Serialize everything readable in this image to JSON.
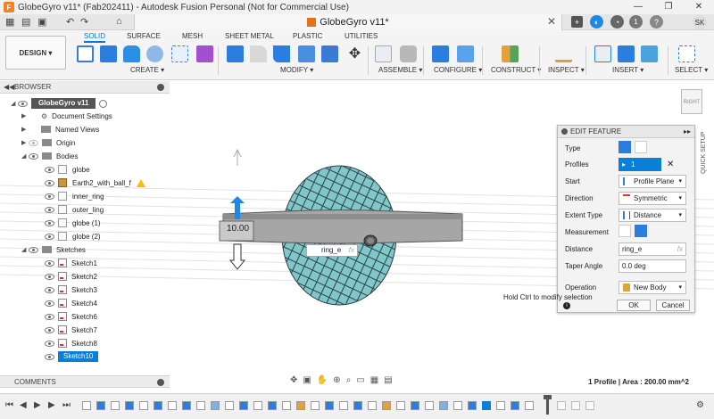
{
  "window": {
    "title": "GlobeGyro v11* (Fab202411) - Autodesk Fusion Personal (Not for Commercial Use)",
    "controls": [
      "—",
      "❐",
      "✕"
    ]
  },
  "doc_tab": {
    "title": "GlobeGyro v11*",
    "close": "✕"
  },
  "tab_bar": {
    "notification_count": "1",
    "avatar_initials": "SK"
  },
  "ribbon": {
    "workspace": "DESIGN",
    "tabs": [
      "SOLID",
      "SURFACE",
      "MESH",
      "SHEET METAL",
      "PLASTIC",
      "UTILITIES"
    ],
    "active_tab": "SOLID",
    "groups": [
      "CREATE ▾",
      "MODIFY ▾",
      "ASSEMBLE ▾",
      "CONFIGURE ▾",
      "CONSTRUCT ▾",
      "INSPECT ▾",
      "INSERT ▾",
      "SELECT ▾"
    ]
  },
  "browser": {
    "header": "BROWSER",
    "items": [
      {
        "label": "GlobeGyro v11",
        "kind": "root"
      },
      {
        "label": "Document Settings",
        "kind": "settings"
      },
      {
        "label": "Named Views",
        "kind": "folder"
      },
      {
        "label": "Origin",
        "kind": "folder"
      },
      {
        "label": "Bodies",
        "kind": "folder"
      },
      {
        "label": "globe",
        "kind": "body"
      },
      {
        "label": "Earth2_with_ball_f",
        "kind": "body"
      },
      {
        "label": "inner_ring",
        "kind": "body"
      },
      {
        "label": "outer_ling",
        "kind": "body"
      },
      {
        "label": "globe (1)",
        "kind": "body"
      },
      {
        "label": "globe (2)",
        "kind": "body"
      },
      {
        "label": "Sketches",
        "kind": "folder"
      },
      {
        "label": "Sketch1",
        "kind": "sketch"
      },
      {
        "label": "Sketch2",
        "kind": "sketch"
      },
      {
        "label": "Sketch3",
        "kind": "sketch"
      },
      {
        "label": "Sketch4",
        "kind": "sketch"
      },
      {
        "label": "Sketch6",
        "kind": "sketch"
      },
      {
        "label": "Sketch7",
        "kind": "sketch"
      },
      {
        "label": "Sketch8",
        "kind": "sketch"
      },
      {
        "label": "Sketch10",
        "kind": "sketch",
        "selected": true
      }
    ]
  },
  "viewport": {
    "distance_badge": "10.00",
    "ring_input": "ring_e",
    "ring_input_fx": "fx",
    "viewcube_label": "RIGHT"
  },
  "edit_feature": {
    "title": "EDIT FEATURE",
    "rows": {
      "type_label": "Type",
      "profiles_label": "Profiles",
      "profiles_value": "1 selected",
      "start_label": "Start",
      "start_value": "Profile Plane",
      "direction_label": "Direction",
      "direction_value": "Symmetric",
      "extent_label": "Extent Type",
      "extent_value": "Distance",
      "measurement_label": "Measurement",
      "distance_label": "Distance",
      "distance_value": "ring_e",
      "distance_fx": "fx",
      "taper_label": "Taper Angle",
      "taper_value": "0.0 deg",
      "operation_label": "Operation",
      "operation_value": "New Body"
    },
    "ok": "OK",
    "cancel": "Cancel"
  },
  "hint": "Hold Ctrl to modify selection",
  "comments": {
    "label": "COMMENTS"
  },
  "status": {
    "text": "1 Profile | Area : 200.00 mm^2"
  },
  "quick_setup": "QUICK SETUP",
  "colors": {
    "accent": "#0a7fd8",
    "globe": "#7fc7c9",
    "ring": "#a6a6a6",
    "arrow": "#1e88e5"
  }
}
